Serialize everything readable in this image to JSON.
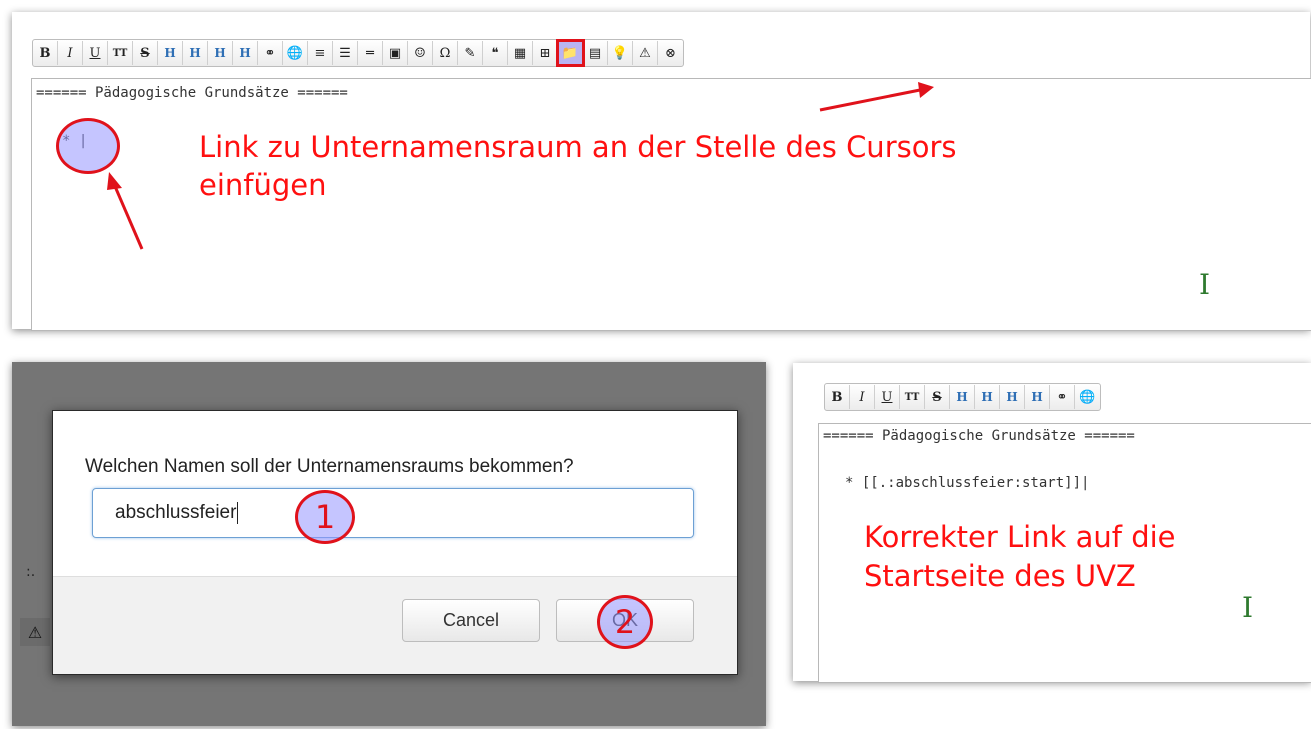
{
  "top_editor": {
    "toolbar_buttons": [
      {
        "name": "bold-button",
        "label": "B",
        "cls": "b"
      },
      {
        "name": "italic-button",
        "label": "I",
        "cls": "i"
      },
      {
        "name": "underline-button",
        "label": "U",
        "cls": "u"
      },
      {
        "name": "monospace-button",
        "label": "TT",
        "cls": "tt"
      },
      {
        "name": "strikethrough-button",
        "label": "S",
        "cls": "s"
      },
      {
        "name": "heading-same-button",
        "label": "H",
        "cls": "h"
      },
      {
        "name": "heading-lower-button",
        "label": "H",
        "cls": "h"
      },
      {
        "name": "heading-higher-button",
        "label": "H",
        "cls": "h"
      },
      {
        "name": "heading-select-button",
        "label": "H",
        "cls": "h"
      },
      {
        "name": "link-button",
        "label": "⚭",
        "cls": ""
      },
      {
        "name": "external-link-button",
        "label": "🌐",
        "cls": ""
      },
      {
        "name": "ordered-list-button",
        "label": "≡",
        "cls": ""
      },
      {
        "name": "unordered-list-button",
        "label": "☰",
        "cls": ""
      },
      {
        "name": "horizontal-rule-button",
        "label": "═",
        "cls": ""
      },
      {
        "name": "image-button",
        "label": "▣",
        "cls": ""
      },
      {
        "name": "smiley-button",
        "label": "☺",
        "cls": ""
      },
      {
        "name": "special-chars-button",
        "label": "Ω",
        "cls": ""
      },
      {
        "name": "signature-button",
        "label": "✎",
        "cls": ""
      },
      {
        "name": "quote-button",
        "label": "❝",
        "cls": ""
      },
      {
        "name": "table-button",
        "label": "▦",
        "cls": ""
      },
      {
        "name": "add-page-button",
        "label": "⊞",
        "cls": ""
      },
      {
        "name": "namespace-link-button",
        "label": "📁",
        "cls": "active"
      },
      {
        "name": "note-button",
        "label": "▤",
        "cls": ""
      },
      {
        "name": "tip-button",
        "label": "💡",
        "cls": ""
      },
      {
        "name": "warning-button",
        "label": "⚠",
        "cls": ""
      },
      {
        "name": "stop-button",
        "label": "⊗",
        "cls": ""
      }
    ],
    "heading_line": "====== Pädagogische Grundsätze ======",
    "list_line": "* |",
    "annotation_line1": "Link zu Unternamensraum an der Stelle des Cursors",
    "annotation_line2": "einfügen"
  },
  "dialog": {
    "prompt": "Welchen Namen soll der Unternamensraums bekommen?",
    "input_value": "abschlussfeier",
    "cancel_label": "Cancel",
    "ok_label": "OK",
    "step1": "1",
    "step2": "2",
    "bg_fragment": ":."
  },
  "right_editor": {
    "toolbar_buttons": [
      {
        "name": "bold-button",
        "label": "B",
        "cls": "b"
      },
      {
        "name": "italic-button",
        "label": "I",
        "cls": "i"
      },
      {
        "name": "underline-button",
        "label": "U",
        "cls": "u"
      },
      {
        "name": "monospace-button",
        "label": "TT",
        "cls": "tt"
      },
      {
        "name": "strikethrough-button",
        "label": "S",
        "cls": "s"
      },
      {
        "name": "heading-same-button",
        "label": "H",
        "cls": "h"
      },
      {
        "name": "heading-lower-button",
        "label": "H",
        "cls": "h"
      },
      {
        "name": "heading-higher-button",
        "label": "H",
        "cls": "h"
      },
      {
        "name": "heading-select-button",
        "label": "H",
        "cls": "h"
      },
      {
        "name": "link-button",
        "label": "⚭",
        "cls": ""
      },
      {
        "name": "external-link-button",
        "label": "🌐",
        "cls": ""
      }
    ],
    "heading_line": "====== Pädagogische Grundsätze ======",
    "list_line": "* [[.:abschlussfeier:start]]|",
    "annotation_line1": "Korrekter Link auf die",
    "annotation_line2": "Startseite des UVZ"
  }
}
